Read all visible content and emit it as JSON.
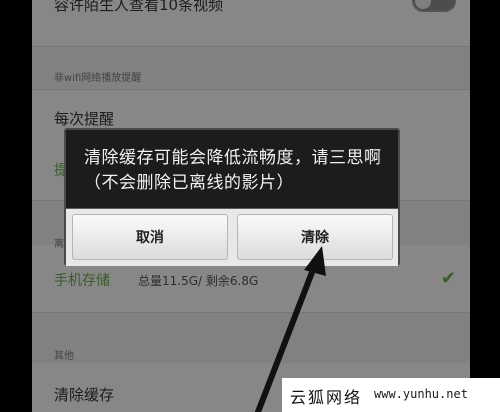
{
  "settings": {
    "stranger_watch_label": "容许陌生人查看10条视频",
    "wifi_section_title": "非wifi网络播放提醒",
    "every_time_label": "每次提醒",
    "partial_green_label": "提",
    "storage_section_title": "离",
    "phone_storage_label": "手机存储",
    "storage_info": "总量11.5G/ 剩余6.8G",
    "other_section_title": "其他",
    "clear_cache_label": "清除缓存"
  },
  "dialog": {
    "message": "清除缓存可能会降低流畅度，请三思啊（不会删除已离线的影片）",
    "cancel_label": "取消",
    "clear_label": "清除"
  },
  "watermark": {
    "site_cn": "云狐网络",
    "url": "www.yunhu.net"
  },
  "colors": {
    "accent_green": "#6aa84f",
    "dialog_bg": "#1c1c1c"
  }
}
